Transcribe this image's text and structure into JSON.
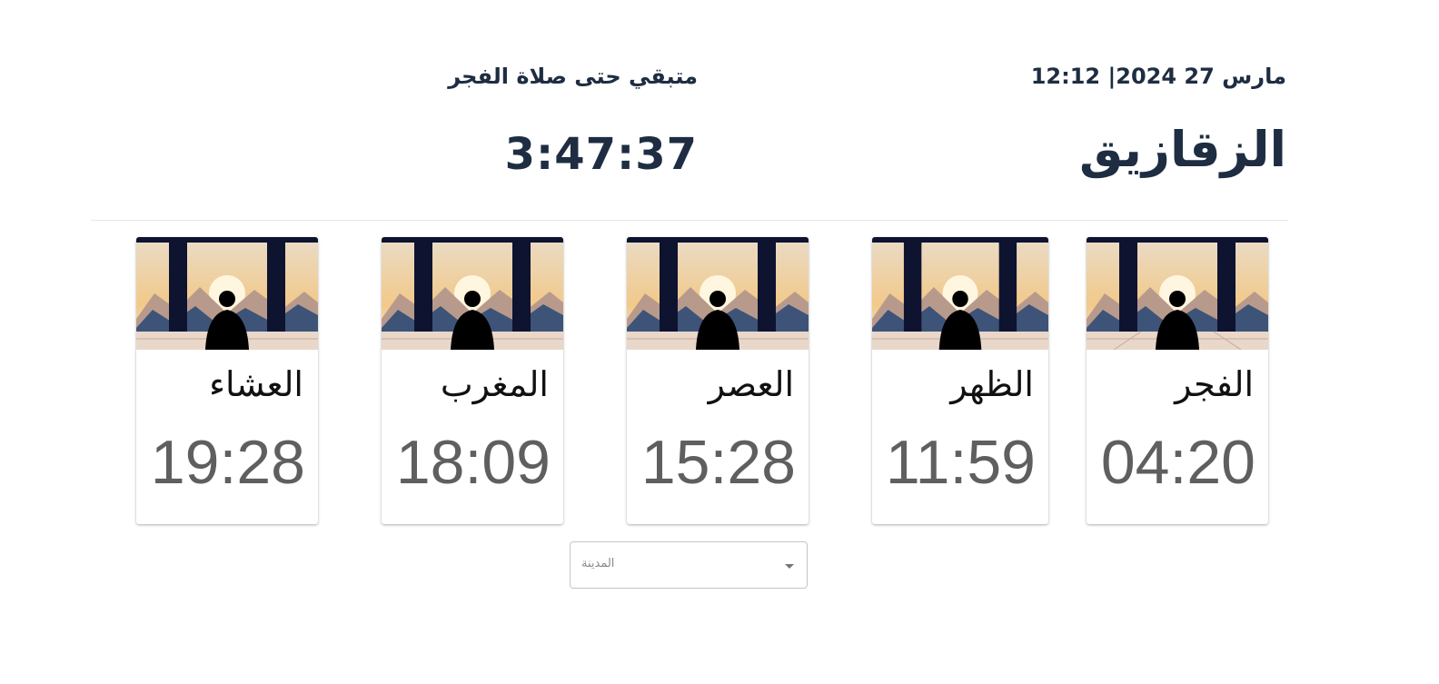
{
  "header": {
    "date_time": "مارس 27 2024| 12:12",
    "remaining_label": "متبقي حتى صلاة الفجر",
    "city": "الزقازيق",
    "countdown": "3:47:37"
  },
  "prayers": [
    {
      "name": "الفجر",
      "time": "04:20"
    },
    {
      "name": "الظهر",
      "time": "11:59"
    },
    {
      "name": "العصر",
      "time": "15:28"
    },
    {
      "name": "المغرب",
      "time": "18:09"
    },
    {
      "name": "العشاء",
      "time": "19:28"
    }
  ],
  "city_select": {
    "placeholder": "المدينة"
  },
  "colors": {
    "heading": "#1e2d42",
    "time_text": "#5f5f5f",
    "accent_dot": "#c0282d"
  }
}
